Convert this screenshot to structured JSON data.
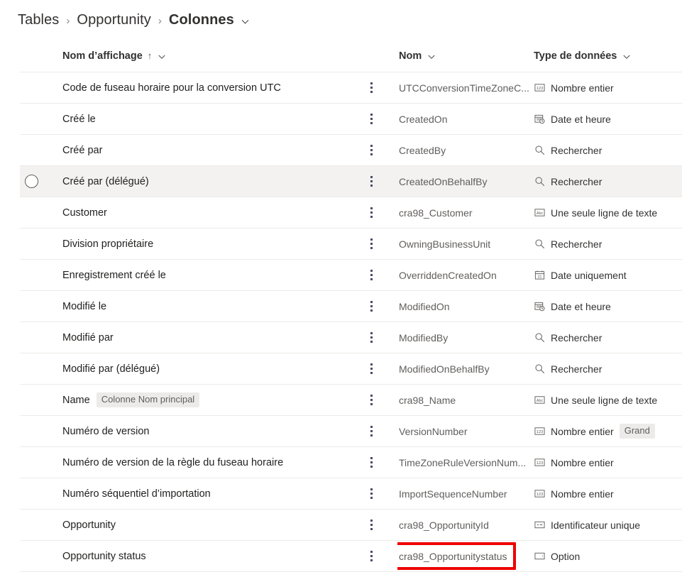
{
  "breadcrumb": {
    "items": [
      "Tables",
      "Opportunity",
      "Colonnes"
    ],
    "separator": "›",
    "chevron": "chevron-down-icon"
  },
  "table": {
    "headers": {
      "display_name": "Nom d’affichage",
      "sort_indicator": "↑",
      "name": "Nom",
      "data_type": "Type de données"
    },
    "rows": [
      {
        "display_name": "Code de fuseau horaire pour la conversion UTC",
        "name": "UTCConversionTimeZoneC...",
        "type": "Nombre entier",
        "type_icon": "integer-123-icon",
        "badge": "",
        "type_badge": "",
        "selected": false,
        "highlighted": false
      },
      {
        "display_name": "Créé le",
        "name": "CreatedOn",
        "type": "Date et heure",
        "type_icon": "datetime-icon",
        "badge": "",
        "type_badge": "",
        "selected": false,
        "highlighted": false
      },
      {
        "display_name": "Créé par",
        "name": "CreatedBy",
        "type": "Rechercher",
        "type_icon": "lookup-search-icon",
        "badge": "",
        "type_badge": "",
        "selected": false,
        "highlighted": false
      },
      {
        "display_name": "Créé par (délégué)",
        "name": "CreatedOnBehalfBy",
        "type": "Rechercher",
        "type_icon": "lookup-search-icon",
        "badge": "",
        "type_badge": "",
        "selected": true,
        "highlighted": false
      },
      {
        "display_name": "Customer",
        "name": "cra98_Customer",
        "type": "Une seule ligne de texte",
        "type_icon": "text-abc-icon",
        "badge": "",
        "type_badge": "",
        "selected": false,
        "highlighted": false
      },
      {
        "display_name": "Division propriétaire",
        "name": "OwningBusinessUnit",
        "type": "Rechercher",
        "type_icon": "lookup-search-icon",
        "badge": "",
        "type_badge": "",
        "selected": false,
        "highlighted": false
      },
      {
        "display_name": "Enregistrement créé le",
        "name": "OverriddenCreatedOn",
        "type": "Date uniquement",
        "type_icon": "date-only-icon",
        "badge": "",
        "type_badge": "",
        "selected": false,
        "highlighted": false
      },
      {
        "display_name": "Modifié le",
        "name": "ModifiedOn",
        "type": "Date et heure",
        "type_icon": "datetime-icon",
        "badge": "",
        "type_badge": "",
        "selected": false,
        "highlighted": false
      },
      {
        "display_name": "Modifié par",
        "name": "ModifiedBy",
        "type": "Rechercher",
        "type_icon": "lookup-search-icon",
        "badge": "",
        "type_badge": "",
        "selected": false,
        "highlighted": false
      },
      {
        "display_name": "Modifié par (délégué)",
        "name": "ModifiedOnBehalfBy",
        "type": "Rechercher",
        "type_icon": "lookup-search-icon",
        "badge": "",
        "type_badge": "",
        "selected": false,
        "highlighted": false
      },
      {
        "display_name": "Name",
        "name": "cra98_Name",
        "type": "Une seule ligne de texte",
        "type_icon": "text-abc-icon",
        "badge": "Colonne Nom principal",
        "type_badge": "",
        "selected": false,
        "highlighted": false
      },
      {
        "display_name": "Numéro de version",
        "name": "VersionNumber",
        "type": "Nombre entier",
        "type_icon": "integer-123-icon",
        "badge": "",
        "type_badge": "Grand",
        "selected": false,
        "highlighted": false
      },
      {
        "display_name": "Numéro de version de la règle du fuseau horaire",
        "name": "TimeZoneRuleVersionNum...",
        "type": "Nombre entier",
        "type_icon": "integer-123-icon",
        "badge": "",
        "type_badge": "",
        "selected": false,
        "highlighted": false
      },
      {
        "display_name": "Numéro séquentiel d’importation",
        "name": "ImportSequenceNumber",
        "type": "Nombre entier",
        "type_icon": "integer-123-icon",
        "badge": "",
        "type_badge": "",
        "selected": false,
        "highlighted": false
      },
      {
        "display_name": "Opportunity",
        "name": "cra98_OpportunityId",
        "type": "Identificateur unique",
        "type_icon": "unique-id-icon",
        "badge": "",
        "type_badge": "",
        "selected": false,
        "highlighted": false
      },
      {
        "display_name": "Opportunity status",
        "name": "cra98_Opportunitystatus",
        "type": "Option",
        "type_icon": "option-set-icon",
        "badge": "",
        "type_badge": "",
        "selected": false,
        "highlighted": true
      }
    ]
  },
  "annotation": {
    "highlight_color": "#ef0000",
    "highlight_target": "cra98_Opportunitystatus"
  },
  "colors": {
    "row_hover": "#f3f2f1",
    "divider": "#edebe9",
    "text_primary": "#201f1e",
    "text_secondary": "#605e5c",
    "badge_bg": "#edebe9"
  }
}
